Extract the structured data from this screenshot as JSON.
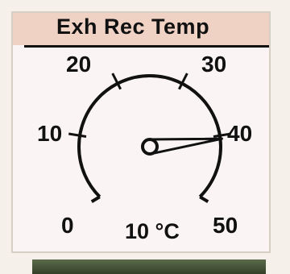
{
  "gauge": {
    "title": "Exh Rec Temp",
    "scale_min": 0,
    "scale_max": 50,
    "ticks": [
      {
        "label": "0",
        "value": 0
      },
      {
        "label": "10",
        "value": 10
      },
      {
        "label": "20",
        "value": 20
      },
      {
        "label": "30",
        "value": 30
      },
      {
        "label": "40",
        "value": 40
      },
      {
        "label": "50",
        "value": 50
      }
    ],
    "readout": "10 °C",
    "needle_value": 40.5,
    "colors": {
      "title_background": "#efd2c4",
      "panel_background": "#fbf4f4",
      "ink": "#111111"
    },
    "icon": "dial-gauge-icon"
  }
}
